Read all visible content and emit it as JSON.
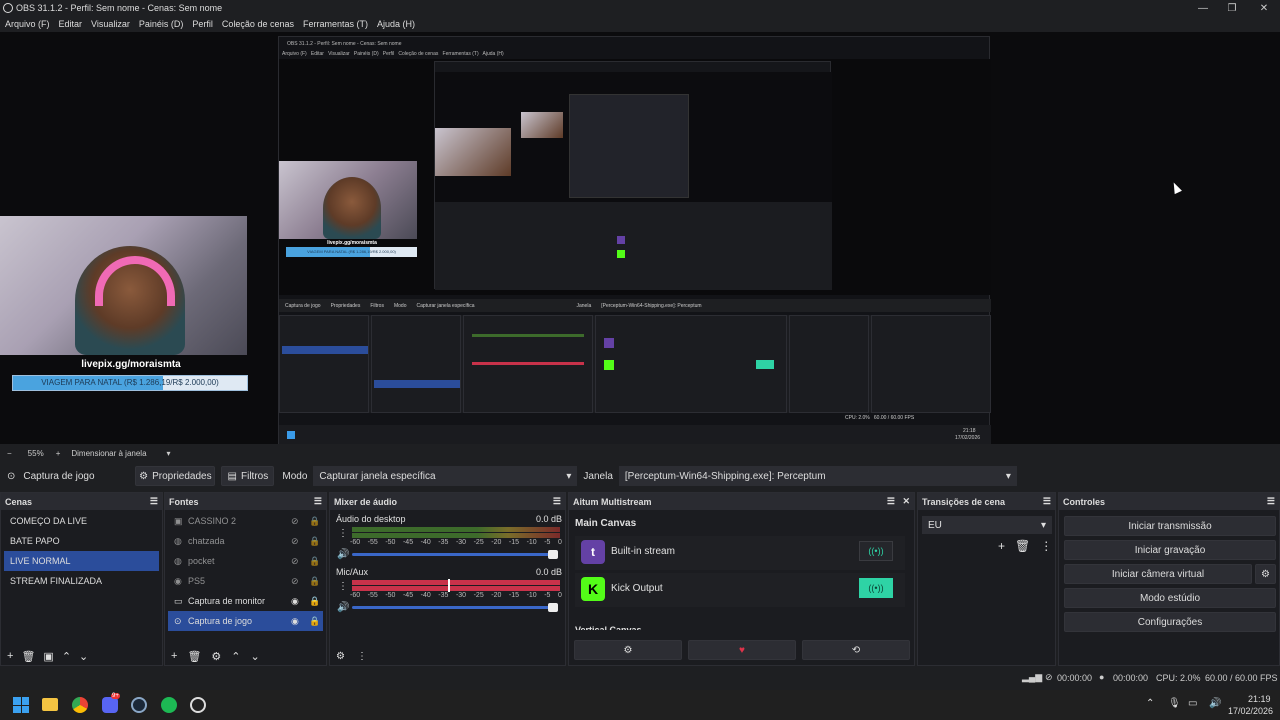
{
  "window": {
    "title": "OBS 31.1.2 - Perfil: Sem nome - Cenas: Sem nome",
    "min": "—",
    "max": "❐",
    "close": "✕"
  },
  "menu": [
    "Arquivo (F)",
    "Editar",
    "Visualizar",
    "Painéis (D)",
    "Perfil",
    "Coleção de cenas",
    "Ferramentas (T)",
    "Ajuda (H)"
  ],
  "preview": {
    "webcam_handle": "livepix.gg/moraismta",
    "goal_text": "VIAGEM PARA NATAL (R$ 1.286,19/R$ 2.000,00)",
    "goal_fraction": 0.643,
    "nested_handle": "livepix.gg/moraismta",
    "nested_goal": "VIAGEM PARA NATAL (R$ 1.286,19/R$ 2.000,00)",
    "nested_title": "OBS 31.1.2 - Perfil: Sem nome - Cenas: Sem nome",
    "nested_menu": "Arquivo (F)   Editar   Visualizar   Painéis (D)   Perfil   Coleção de cenas   Ferramentas (T)   Ajuda (H)",
    "nested_toolbar": [
      "Captura de jogo",
      "Propriedades",
      "Filtros",
      "Modo",
      "Capturar janela específica",
      "Janela",
      "[Perceptum-Win64-Shipping.exe]: Perceptum"
    ],
    "nested_clock": "21:18",
    "nested_date": "17/02/2026",
    "nested_status": "CPU: 2.0%   60.00 / 60.00 FPS"
  },
  "zoom": {
    "minus": "−",
    "value": "55%",
    "plus": "+",
    "mode": "Dimensionar à janela"
  },
  "source_toolbar": {
    "source": "Captura de jogo",
    "properties": "Propriedades",
    "filters": "Filtros",
    "mode_label": "Modo",
    "mode_value": "Capturar janela específica",
    "window_label": "Janela",
    "window_value": "[Perceptum-Win64-Shipping.exe]: Perceptum"
  },
  "scenes": {
    "title": "Cenas",
    "items": [
      "COMEÇO DA LIVE",
      "BATE PAPO",
      "LIVE NORMAL",
      "STREAM FINALIZADA"
    ],
    "selected": "LIVE NORMAL"
  },
  "sources": {
    "title": "Fontes",
    "items": [
      {
        "name": "CASSINO 2",
        "icon": "image-icon",
        "visible": false
      },
      {
        "name": "chatzada",
        "icon": "browser-icon",
        "visible": false
      },
      {
        "name": "pocket",
        "icon": "browser-icon",
        "visible": false
      },
      {
        "name": "PS5",
        "icon": "camera-icon",
        "visible": false
      },
      {
        "name": "Captura de monitor",
        "icon": "monitor-icon",
        "visible": true
      },
      {
        "name": "Captura de jogo",
        "icon": "gamepad-icon",
        "visible": true
      }
    ]
  },
  "mixer": {
    "title": "Mixer de áudio",
    "channels": [
      {
        "name": "Áudio do desktop",
        "db": "0.0 dB"
      },
      {
        "name": "Mic/Aux",
        "db": "0.0 dB"
      }
    ],
    "scale": [
      "-60",
      "-55",
      "-50",
      "-45",
      "-40",
      "-35",
      "-30",
      "-25",
      "-20",
      "-15",
      "-10",
      "-5",
      "0"
    ]
  },
  "multistream": {
    "title": "Aitum Multistream",
    "section": "Main Canvas",
    "outputs": [
      {
        "name": "Built-in stream",
        "color": "#6441a5"
      },
      {
        "name": "Kick Output",
        "color": "#53fc18"
      }
    ],
    "vertical": "Vertical Canvas"
  },
  "transitions": {
    "title": "Transições de cena",
    "value": "EU"
  },
  "controls": {
    "title": "Controles",
    "buttons": [
      "Iniciar transmissão",
      "Iniciar gravação",
      "Iniciar câmera virtual",
      "Modo estúdio",
      "Configurações"
    ]
  },
  "status": {
    "stream_time": "00:00:00",
    "rec_time": "00:00:00",
    "cpu": "CPU: 2.0%",
    "fps": "60.00 / 60.00 FPS"
  },
  "taskbar": {
    "time": "21:19",
    "date": "17/02/2026",
    "discord_badge": "9+"
  }
}
